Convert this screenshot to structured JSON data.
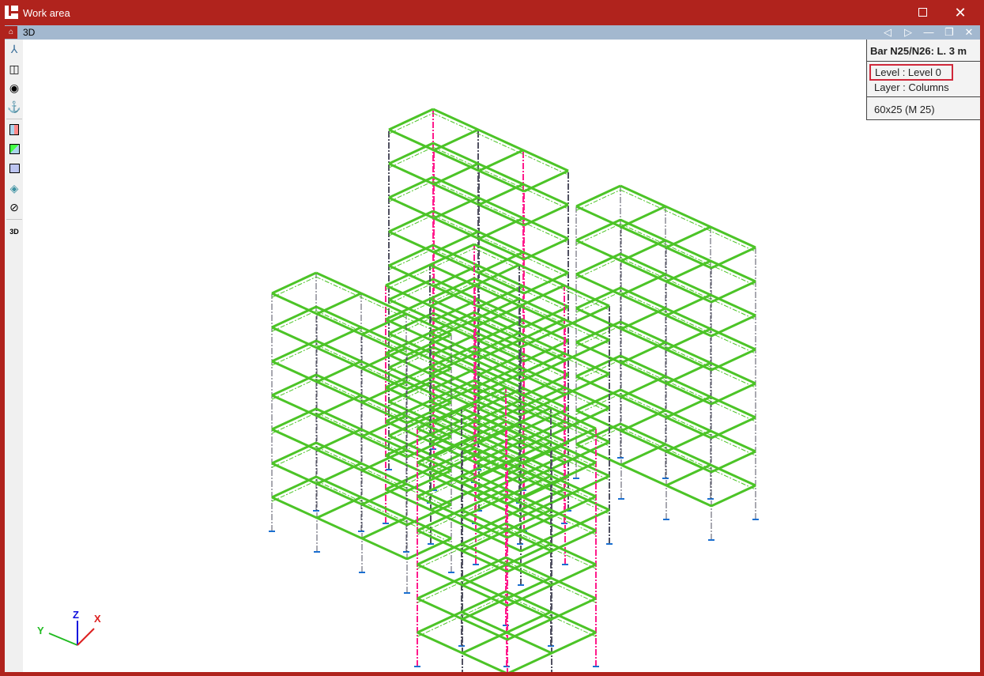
{
  "window": {
    "title": "Work area",
    "maximize_icon": "maximize-icon",
    "close_icon": "close-icon"
  },
  "document": {
    "title": "3D",
    "prev": "◁",
    "next": "▷",
    "minimize": "—",
    "restore": "❐",
    "close": "✕"
  },
  "toolbar": {
    "items": [
      "axes-view-icon",
      "cube-view-icon",
      "orbit-icon",
      "rotate-icon",
      "section-red-icon",
      "section-green-icon",
      "section-plan-icon",
      "layers-icon",
      "hide-icon",
      "3d-settings-icon"
    ]
  },
  "info_panel": {
    "header": "Bar N25/N26: L. 3 m",
    "level": "Level  : Level 0",
    "layer": "Layer : Columns",
    "section": "60x25 (M 25)"
  },
  "axes": {
    "x": "X",
    "y": "Y",
    "z": "Z"
  },
  "colors": {
    "beam": "#4cc427",
    "column_selected": "#ff1a8c",
    "column": "#505060",
    "support": "#1a6fd0"
  }
}
